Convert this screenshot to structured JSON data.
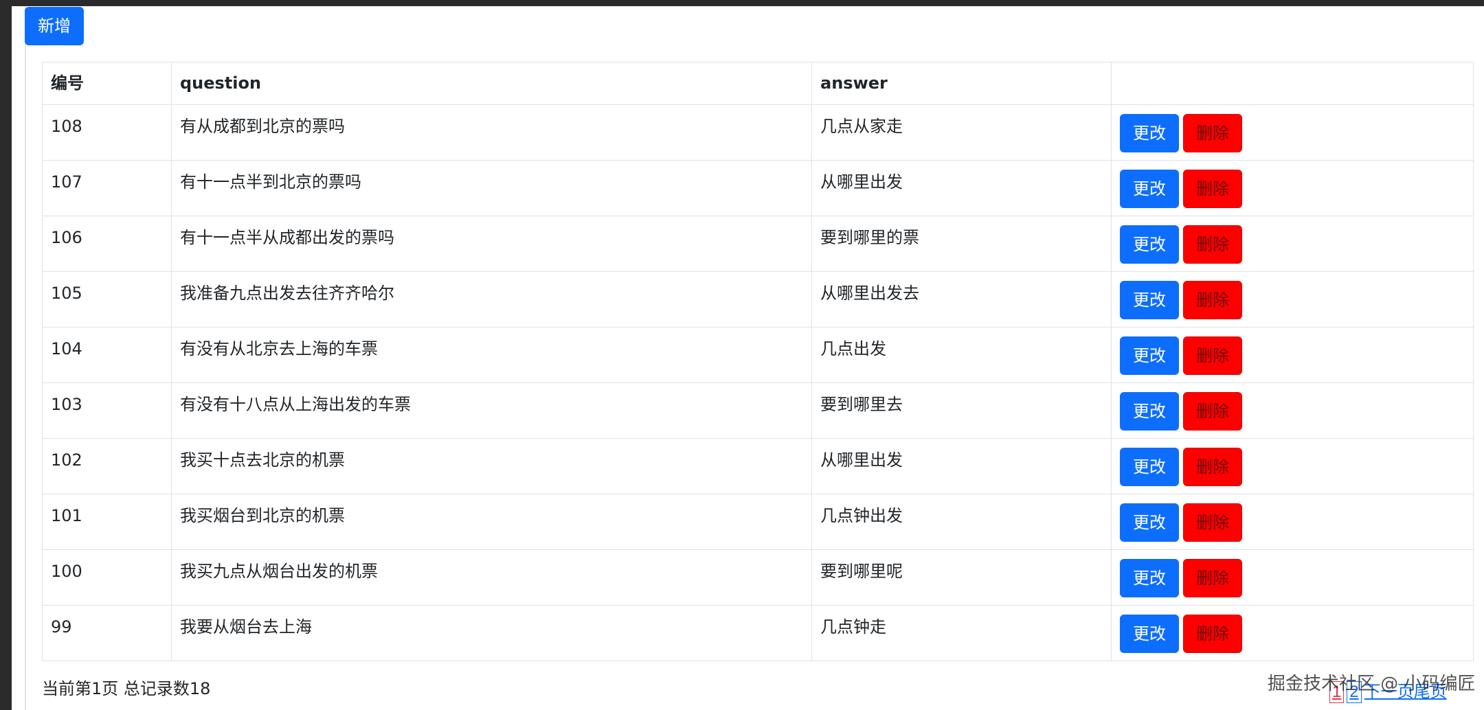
{
  "toolbar": {
    "add_label": "新增"
  },
  "table": {
    "headers": {
      "id": "编号",
      "question": "question",
      "answer": "answer",
      "actions": ""
    },
    "rows": [
      {
        "id": "108",
        "question": "有从成都到北京的票吗",
        "answer": "几点从家走",
        "edit": "更改",
        "delete": "删除"
      },
      {
        "id": "107",
        "question": "有十一点半到北京的票吗",
        "answer": "从哪里出发",
        "edit": "更改",
        "delete": "删除"
      },
      {
        "id": "106",
        "question": "有十一点半从成都出发的票吗",
        "answer": "要到哪里的票",
        "edit": "更改",
        "delete": "删除"
      },
      {
        "id": "105",
        "question": "我准备九点出发去往齐齐哈尔",
        "answer": "从哪里出发去",
        "edit": "更改",
        "delete": "删除"
      },
      {
        "id": "104",
        "question": "有没有从北京去上海的车票",
        "answer": "几点出发",
        "edit": "更改",
        "delete": "删除"
      },
      {
        "id": "103",
        "question": "有没有十八点从上海出发的车票",
        "answer": "要到哪里去",
        "edit": "更改",
        "delete": "删除"
      },
      {
        "id": "102",
        "question": "我买十点去北京的机票",
        "answer": "从哪里出发",
        "edit": "更改",
        "delete": "删除"
      },
      {
        "id": "101",
        "question": "我买烟台到北京的机票",
        "answer": "几点钟出发",
        "edit": "更改",
        "delete": "删除"
      },
      {
        "id": "100",
        "question": "我买九点从烟台出发的机票",
        "answer": "要到哪里呢",
        "edit": "更改",
        "delete": "删除"
      },
      {
        "id": "99",
        "question": "我要从烟台去上海",
        "answer": "几点钟走",
        "edit": "更改",
        "delete": "删除"
      }
    ]
  },
  "footer": {
    "info": "当前第1页 总记录数18"
  },
  "pagination": {
    "pages": [
      "1",
      "2"
    ],
    "current": "1",
    "next": "下一页",
    "last": "尾页"
  },
  "watermark": "掘金技术社区 @ 小码编匠",
  "colors": {
    "primary": "#0d6efd",
    "danger": "#ff0000",
    "active_page": "#dc3545"
  }
}
